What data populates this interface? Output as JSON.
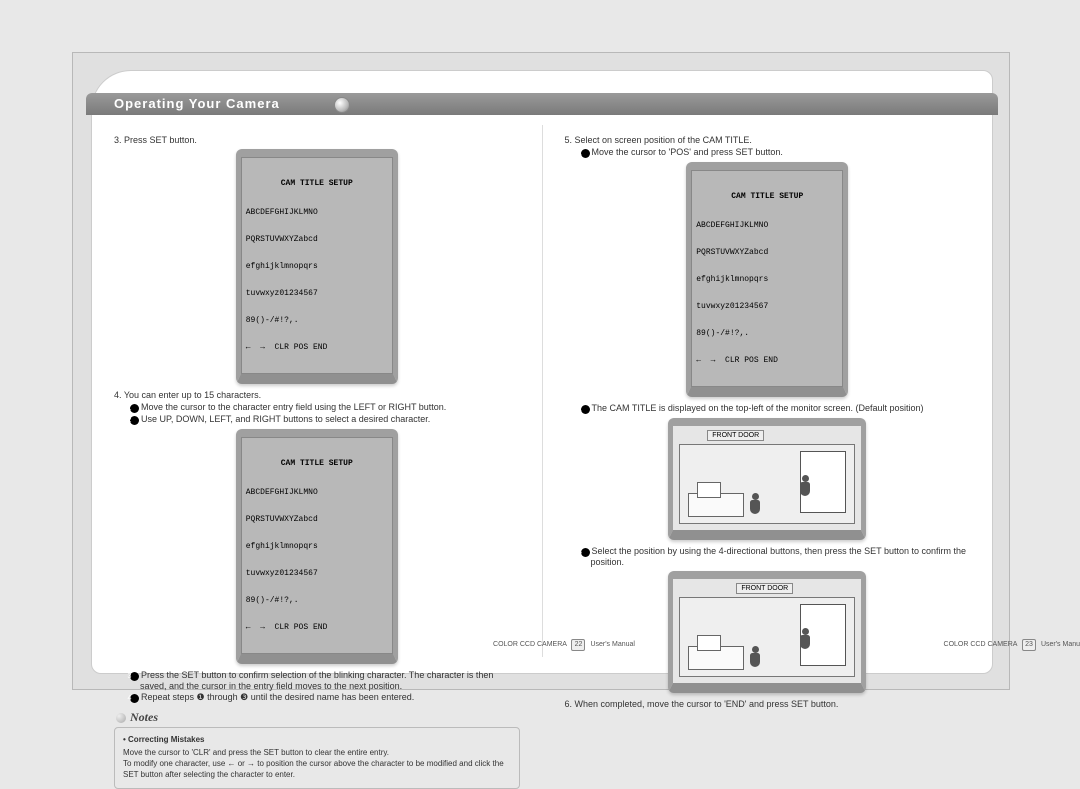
{
  "heading": "Operating Your Camera",
  "left": {
    "step3": "3. Press SET button.",
    "step4": "4. You can enter up to 15 characters.",
    "sub1": "Move the cursor to the character entry field using the LEFT or RIGHT button.",
    "sub2": "Use UP, DOWN, LEFT, and RIGHT buttons to select a desired character.",
    "sub3": "Press the SET button to confirm selection of the blinking character. The character is then saved, and the cursor in the entry field moves to the next position.",
    "sub4": "Repeat steps ❶ through ❸ until the desired name has been entered.",
    "notes_label": "Notes",
    "notes_head": "• Correcting Mistakes",
    "notes_body": "Move the cursor to 'CLR' and press the SET button to clear the entire entry.\nTo modify one character, use ← or → to position the cursor above the character to be modified and click the SET button after selecting the character to enter."
  },
  "right": {
    "step5": "5. Select on screen position of the CAM TITLE.",
    "sub1": "Move the cursor to 'POS' and press SET button.",
    "sub2": "The CAM TITLE is displayed on the top-left of the monitor screen. (Default position)",
    "sub3": "Select the position by using the 4-directional buttons, then press the SET button to confirm the position.",
    "step6": "6. When completed, move the cursor to 'END' and press SET button.",
    "scene_label": "FRONT DOOR"
  },
  "crt": {
    "title": "CAM TITLE SETUP",
    "row1": "ABCDEFGHIJKLMNO",
    "row2": "PQRSTUVWXYZabcd",
    "row3": "efghijklmnopqrs",
    "row4": "tuvwxyz01234567",
    "row5": "89()-/#!?,.",
    "row6": "←  →  CLR POS END"
  },
  "footer": {
    "left_prod": "COLOR CCD CAMERA",
    "left_page": "22",
    "label": "User's Manual",
    "right_prod": "COLOR CCD CAMERA",
    "right_page": "23"
  }
}
